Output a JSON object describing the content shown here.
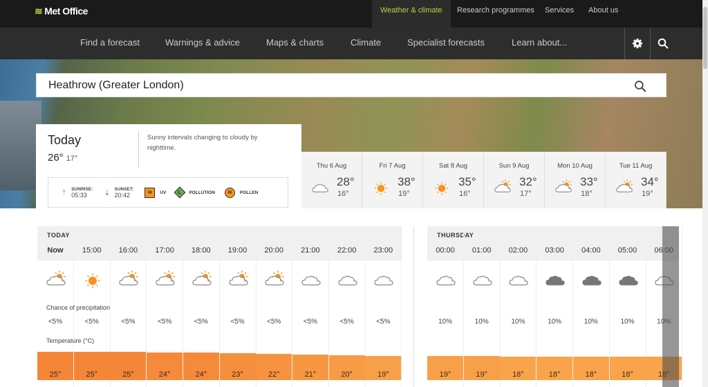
{
  "header": {
    "logo": "Met Office",
    "top_links": [
      "Weather & climate",
      "Research programmes",
      "Services",
      "About us"
    ],
    "active_top": "Weather & climate",
    "nav": [
      "Find a forecast",
      "Warnings & advice",
      "Maps & charts",
      "Climate",
      "Specialist forecasts",
      "Learn about..."
    ],
    "icons": [
      "gear-icon",
      "search-icon"
    ]
  },
  "search": {
    "value": "Heathrow (Greater London)"
  },
  "today": {
    "title": "Today",
    "high": "26°",
    "low": "17°",
    "summary": "Sunny intervals changing to cloudy by nighttime.",
    "sunrise_label": "SUNRISE:",
    "sunrise": "05:33",
    "sunset_label": "SUNSET:",
    "sunset": "20:42",
    "uv": {
      "level": "H",
      "label": "UV",
      "color": "#f7941d"
    },
    "pollution": {
      "level": "L",
      "label": "POLLUTION",
      "color": "#6aa84f"
    },
    "pollen": {
      "level": "H",
      "label": "POLLEN",
      "color": "#f7941d"
    }
  },
  "daily": [
    {
      "date": "Thu 6 Aug",
      "high": "28°",
      "low": "16°",
      "icon": "cloud"
    },
    {
      "date": "Fri 7 Aug",
      "high": "38°",
      "low": "19°",
      "icon": "sun"
    },
    {
      "date": "Sat 8 Aug",
      "high": "35°",
      "low": "16°",
      "icon": "sun"
    },
    {
      "date": "Sun 9 Aug",
      "high": "32°",
      "low": "17°",
      "icon": "sun-cloud"
    },
    {
      "date": "Mon 10 Aug",
      "high": "33°",
      "low": "18°",
      "icon": "sun-cloud"
    },
    {
      "date": "Tue 11 Aug",
      "high": "34°",
      "low": "19°",
      "icon": "sun-cloud"
    }
  ],
  "hourly": {
    "precip_label": "Chance of precipitation",
    "temp_label": "Temperature (°C)",
    "sections": [
      {
        "title": "TODAY",
        "hours": [
          {
            "time": "Now",
            "icon": "sun-cloud",
            "precip": "<5%",
            "temp": 25
          },
          {
            "time": "15:00",
            "icon": "sun",
            "precip": "<5%",
            "temp": 25
          },
          {
            "time": "16:00",
            "icon": "sun-cloud",
            "precip": "<5%",
            "temp": 25
          },
          {
            "time": "17:00",
            "icon": "sun-cloud",
            "precip": "<5%",
            "temp": 24
          },
          {
            "time": "18:00",
            "icon": "sun-cloud",
            "precip": "<5%",
            "temp": 24
          },
          {
            "time": "19:00",
            "icon": "sun-cloud",
            "precip": "<5%",
            "temp": 23
          },
          {
            "time": "20:00",
            "icon": "sun-cloud",
            "precip": "<5%",
            "temp": 22
          },
          {
            "time": "21:00",
            "icon": "cloud",
            "precip": "<5%",
            "temp": 21
          },
          {
            "time": "22:00",
            "icon": "cloud",
            "precip": "<5%",
            "temp": 20
          },
          {
            "time": "23:00",
            "icon": "cloud",
            "precip": "<5%",
            "temp": 19
          }
        ]
      },
      {
        "title": "THURSDAY",
        "hours": [
          {
            "time": "00:00",
            "icon": "cloud",
            "precip": "10%",
            "temp": 19
          },
          {
            "time": "01:00",
            "icon": "cloud",
            "precip": "10%",
            "temp": 19
          },
          {
            "time": "02:00",
            "icon": "cloud",
            "precip": "10%",
            "temp": 18
          },
          {
            "time": "03:00",
            "icon": "thick-cloud",
            "precip": "10%",
            "temp": 18
          },
          {
            "time": "04:00",
            "icon": "thick-cloud",
            "precip": "10%",
            "temp": 18
          },
          {
            "time": "05:00",
            "icon": "thick-cloud",
            "precip": "10%",
            "temp": 18
          },
          {
            "time": "06:00",
            "icon": "cloud",
            "precip": "10%",
            "temp": 18
          }
        ]
      }
    ]
  }
}
